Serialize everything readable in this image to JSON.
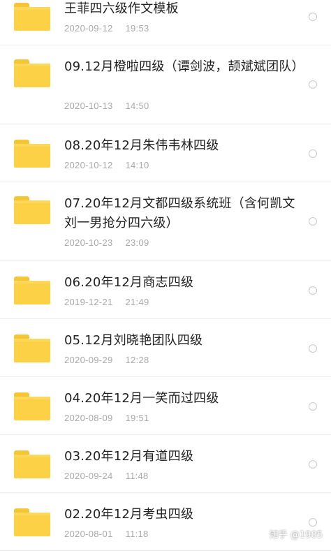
{
  "files": [
    {
      "name": "王菲四六级作文模板",
      "date": "2020-09-12",
      "time": "19:53",
      "icon": "folder-icon"
    },
    {
      "name": "09.12月橙啦四级（谭剑波，颉斌斌团队）",
      "date": "2020-10-13",
      "time": "14:50",
      "icon": "folder-icon"
    },
    {
      "name": "08.20年12月朱伟韦林四级",
      "date": "2020-10-12",
      "time": "14:10",
      "icon": "folder-icon"
    },
    {
      "name": "07.20年12月文都四级系统班（含何凯文刘一男抢分四六级）",
      "date": "2020-10-23",
      "time": "23:09",
      "icon": "folder-icon"
    },
    {
      "name": "06.20年12月商志四级",
      "date": "2019-12-21",
      "time": "21:49",
      "icon": "folder-icon"
    },
    {
      "name": "05.12月刘晓艳团队四级",
      "date": "2020-09-29",
      "time": "12:28",
      "icon": "folder-icon"
    },
    {
      "name": "04.20年12月一笑而过四级",
      "date": "2020-08-09",
      "time": "19:51",
      "icon": "folder-icon"
    },
    {
      "name": "03.20年12月有道四级",
      "date": "2020-09-24",
      "time": "11:48",
      "icon": "folder-icon"
    },
    {
      "name": "02.20年12月考虫四级",
      "date": "2020-08-01",
      "time": "11:18",
      "icon": "folder-icon"
    }
  ],
  "watermark": "知乎 @1905",
  "colors": {
    "folder": "#fdd146",
    "title": "#222222",
    "meta": "#a9a9a9"
  }
}
